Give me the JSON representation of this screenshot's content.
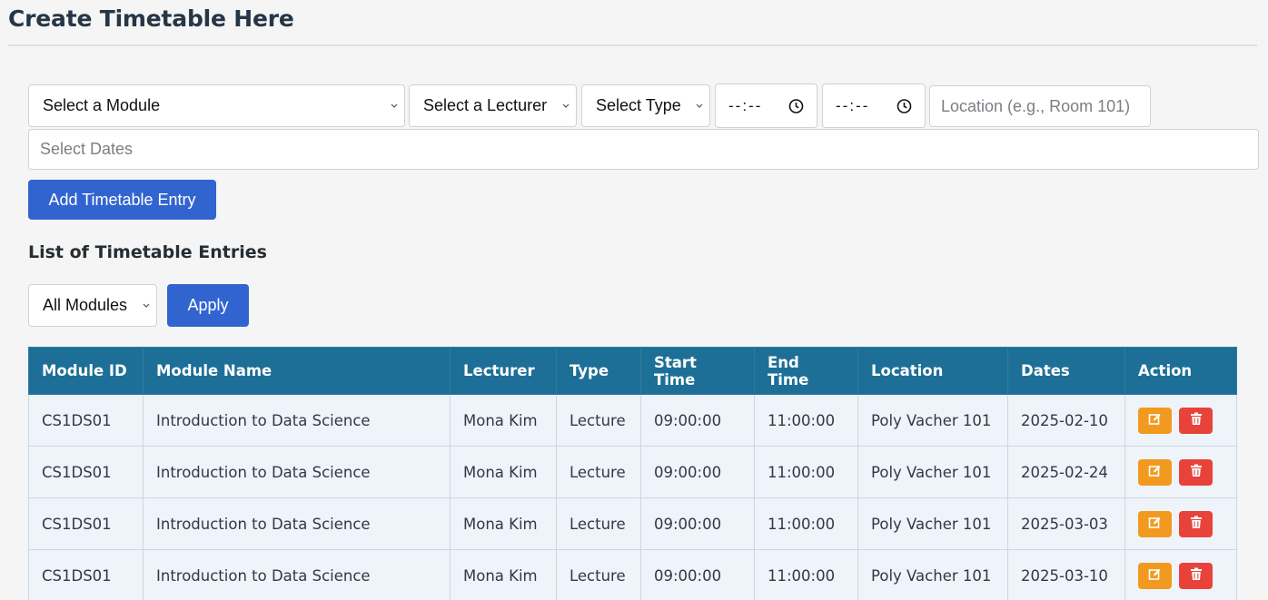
{
  "page": {
    "title": "Create Timetable Here"
  },
  "form": {
    "module_select": "Select a Module",
    "lecturer_select": "Select a Lecturer",
    "type_select": "Select Type",
    "start_time": "--:--",
    "end_time": "--:--",
    "location_placeholder": "Location (e.g., Room 101)",
    "dates_placeholder": "Select Dates",
    "add_button": "Add Timetable Entry"
  },
  "list": {
    "title": "List of Timetable Entries",
    "filter_select": "All Modules",
    "apply_button": "Apply",
    "columns": [
      "Module ID",
      "Module Name",
      "Lecturer",
      "Type",
      "Start Time",
      "End Time",
      "Location",
      "Dates",
      "Action"
    ],
    "rows": [
      {
        "module_id": "CS1DS01",
        "module_name": "Introduction to Data Science",
        "lecturer": "Mona Kim",
        "type": "Lecture",
        "start": "09:00:00",
        "end": "11:00:00",
        "location": "Poly Vacher 101",
        "date": "2025-02-10"
      },
      {
        "module_id": "CS1DS01",
        "module_name": "Introduction to Data Science",
        "lecturer": "Mona Kim",
        "type": "Lecture",
        "start": "09:00:00",
        "end": "11:00:00",
        "location": "Poly Vacher 101",
        "date": "2025-02-24"
      },
      {
        "module_id": "CS1DS01",
        "module_name": "Introduction to Data Science",
        "lecturer": "Mona Kim",
        "type": "Lecture",
        "start": "09:00:00",
        "end": "11:00:00",
        "location": "Poly Vacher 101",
        "date": "2025-03-03"
      },
      {
        "module_id": "CS1DS01",
        "module_name": "Introduction to Data Science",
        "lecturer": "Mona Kim",
        "type": "Lecture",
        "start": "09:00:00",
        "end": "11:00:00",
        "location": "Poly Vacher 101",
        "date": "2025-03-10"
      }
    ]
  },
  "icons": {
    "edit": "edit-icon",
    "delete": "trash-icon",
    "chevron": "chevron-down-icon",
    "clock": "clock-icon"
  },
  "colors": {
    "header": "#1e6f97",
    "primary": "#3264d0",
    "edit": "#f29a1f",
    "delete": "#e8433a"
  }
}
